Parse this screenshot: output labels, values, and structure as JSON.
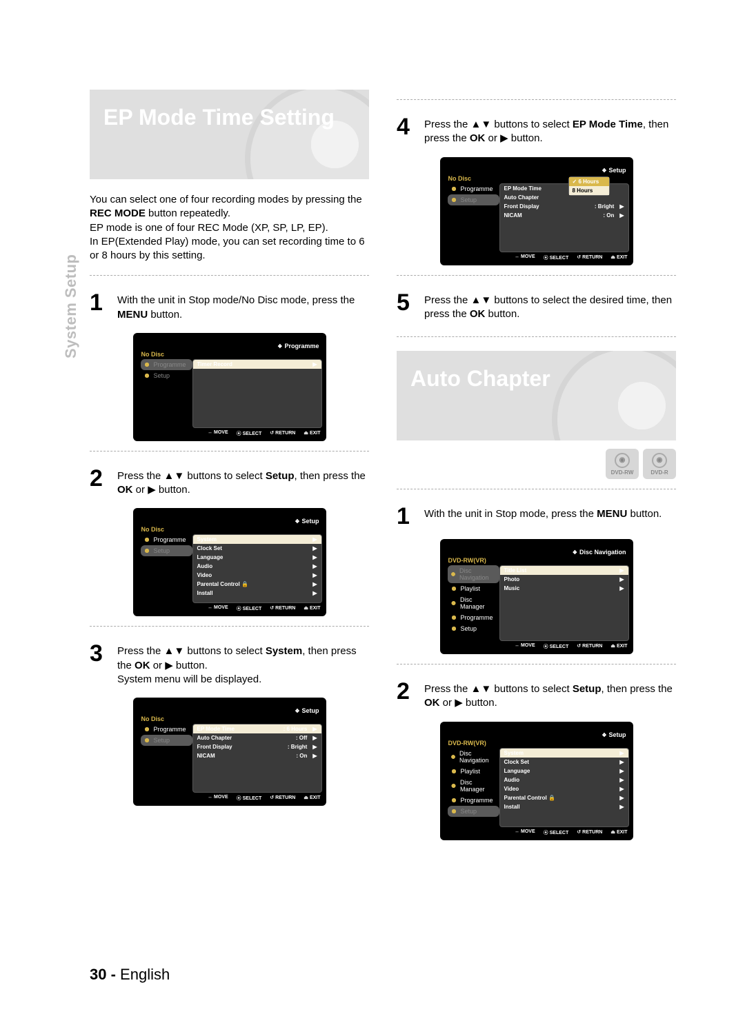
{
  "side_tab": "System Setup",
  "page": {
    "num": "30",
    "lang": "English"
  },
  "triangles": {
    "up": "▲",
    "down": "▼",
    "right": "▶"
  },
  "ep": {
    "title": "EP Mode Time Setting",
    "intro_parts": [
      "You can select one of four recording modes by pressing the ",
      "REC MODE",
      " button repeatedly.\nEP mode is one of four REC Mode (XP, SP, LP, EP).\nIn EP(Extended Play) mode, you can set recording time to 6 or 8 hours by this setting."
    ],
    "steps": {
      "s1": {
        "n": "1",
        "pre": "With the unit in Stop mode/No Disc mode, press the ",
        "b1": "MENU",
        "post": " button."
      },
      "s2": {
        "n": "2",
        "pre": "Press the ",
        "mid": " buttons to select ",
        "b1": "Setup",
        "mid2": ", then press the ",
        "b2": "OK",
        "mid3": " or ",
        "post": " button."
      },
      "s3": {
        "n": "3",
        "pre": "Press the ",
        "mid": " buttons to select ",
        "b1": "System",
        "mid2": ", then press the ",
        "b2": "OK",
        "mid3": " or ",
        "post": " button.\nSystem menu will be displayed."
      },
      "s4": {
        "n": "4",
        "pre": "Press the ",
        "mid": " buttons to select ",
        "b1": "EP Mode Time",
        "mid2": ", then press the ",
        "b2": "OK",
        "mid3": " or ",
        "post": " button."
      },
      "s5": {
        "n": "5",
        "pre": "Press the ",
        "mid": " buttons to select the desired time, then press the ",
        "b1": "OK",
        "post": " button."
      }
    }
  },
  "ac": {
    "title": "Auto Chapter",
    "badges": [
      "DVD-RW",
      "DVD-R"
    ],
    "steps": {
      "s1": {
        "n": "1",
        "pre": "With the unit in Stop mode, press the ",
        "b1": "MENU",
        "post": " button."
      },
      "s2": {
        "n": "2",
        "pre": "Press the ",
        "mid": " buttons to select ",
        "b1": "Setup",
        "mid2": ", then press the ",
        "b2": "OK",
        "mid3": " or ",
        "post": " button."
      }
    }
  },
  "ui": {
    "footer": {
      "move": "MOVE",
      "select": "SELECT",
      "return": "RETURN",
      "exit": "EXIT"
    },
    "left_nodisc": {
      "title": "No Disc",
      "items": [
        "Programme",
        "Setup"
      ]
    },
    "left_dvdrw": {
      "title": "DVD-RW(VR)",
      "items": [
        "Disc Navigation",
        "Playlist",
        "Disc Manager",
        "Programme",
        "Setup"
      ]
    },
    "screen1": {
      "header": "Programme",
      "right": [
        "Timer Record"
      ]
    },
    "screen2": {
      "header": "Setup",
      "right": [
        "System",
        "Clock Set",
        "Language",
        "Audio",
        "Video",
        "Parental Control",
        "Install"
      ],
      "lock_label": "Parental Control 🔒"
    },
    "screen3": {
      "header": "Setup",
      "right": [
        {
          "lbl": "EP Mode Time",
          "val": ": 6 Hours"
        },
        {
          "lbl": "Auto Chapter",
          "val": ": Off"
        },
        {
          "lbl": "Front Display",
          "val": ": Bright"
        },
        {
          "lbl": "NICAM",
          "val": ": On"
        }
      ]
    },
    "screen4": {
      "header": "Setup",
      "right": [
        {
          "lbl": "EP Mode Time",
          "val": ""
        },
        {
          "lbl": "Auto Chapter",
          "val": ""
        },
        {
          "lbl": "Front Display",
          "val": ": Bright"
        },
        {
          "lbl": "NICAM",
          "val": ": On"
        }
      ],
      "popup": [
        {
          "lbl": "6 Hours",
          "state": "checked"
        },
        {
          "lbl": "8 Hours",
          "state": "sel"
        }
      ]
    },
    "screen5": {
      "header": "Disc Navigation",
      "right": [
        "Title List",
        "Photo",
        "Music"
      ]
    },
    "screen6": {
      "header": "Setup",
      "right": [
        "System",
        "Clock Set",
        "Language",
        "Audio",
        "Video",
        "Parental Control",
        "Install"
      ]
    }
  }
}
